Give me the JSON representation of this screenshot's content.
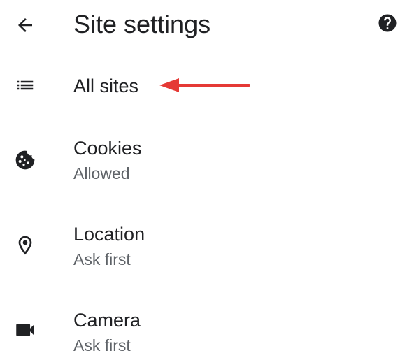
{
  "header": {
    "title": "Site settings",
    "back_icon": "arrow-back-icon",
    "help_icon": "help-icon"
  },
  "rows": [
    {
      "icon": "list-icon",
      "title": "All sites",
      "subtitle": ""
    },
    {
      "icon": "cookie-icon",
      "title": "Cookies",
      "subtitle": "Allowed"
    },
    {
      "icon": "location-pin-icon",
      "title": "Location",
      "subtitle": "Ask first"
    },
    {
      "icon": "videocam-icon",
      "title": "Camera",
      "subtitle": "Ask first"
    }
  ],
  "annotation": {
    "arrow_color": "#e53935",
    "points_to": "All sites"
  },
  "colors": {
    "text_primary": "#202124",
    "text_secondary": "#5f6368",
    "icon": "#202124",
    "background": "#ffffff"
  }
}
